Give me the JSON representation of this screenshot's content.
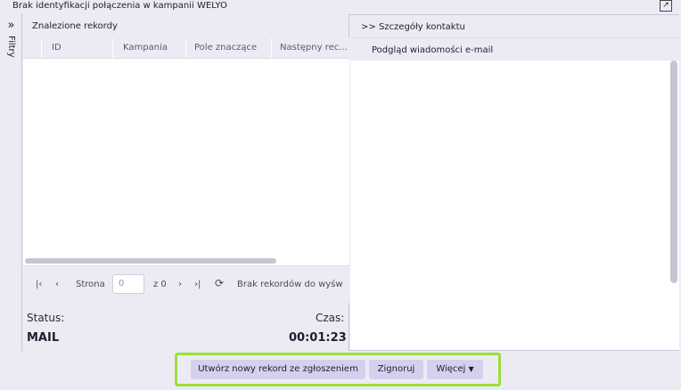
{
  "window": {
    "title": "Brak identyfikacji połączenia w kampanii WELYO"
  },
  "filters": {
    "label": "Filtry",
    "chevron": "»"
  },
  "records_panel": {
    "title": "Znalezione rekordy",
    "columns": [
      "ID",
      "Kampania",
      "Pole znaczące",
      "Następny rec..."
    ],
    "pager": {
      "page_label": "Strona",
      "page_value": "0",
      "of_label": "z 0",
      "empty_text": "Brak rekordów do wyśw"
    }
  },
  "status": {
    "label": "Status:",
    "value": "MAIL"
  },
  "timer": {
    "label": "Czas:",
    "value": "00:01:23"
  },
  "contact_panel": {
    "title": "Szczegóły kontaktu",
    "chevron": ">>",
    "subtitle": "Podgląd wiadomości e-mail"
  },
  "footer": {
    "create_button": "Utwórz nowy rekord ze zgłoszeniem",
    "ignore_button": "Zignoruj",
    "more_button": "Więcej"
  },
  "colors": {
    "highlight": "#9be03a",
    "button_bg": "#d4d1ee"
  }
}
